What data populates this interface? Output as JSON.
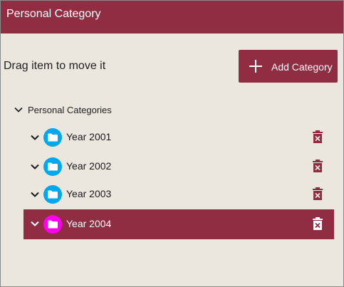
{
  "window": {
    "title": "Personal Category"
  },
  "toolbar": {
    "hint": "Drag item to move it",
    "add_label": "Add Category"
  },
  "tree": {
    "root_label": "Personal Categories",
    "items": [
      {
        "label": "Year 2001",
        "selected": false
      },
      {
        "label": "Year 2002",
        "selected": false
      },
      {
        "label": "Year 2003",
        "selected": false
      },
      {
        "label": "Year 2004",
        "selected": true
      }
    ]
  },
  "colors": {
    "brand": "#902d42",
    "background": "#ebe7df",
    "folder": "#00a8f0",
    "folder_selected": "#ff00f0"
  },
  "icons": [
    "plus-icon",
    "chevron-down-icon",
    "folder-icon",
    "delete-icon"
  ]
}
